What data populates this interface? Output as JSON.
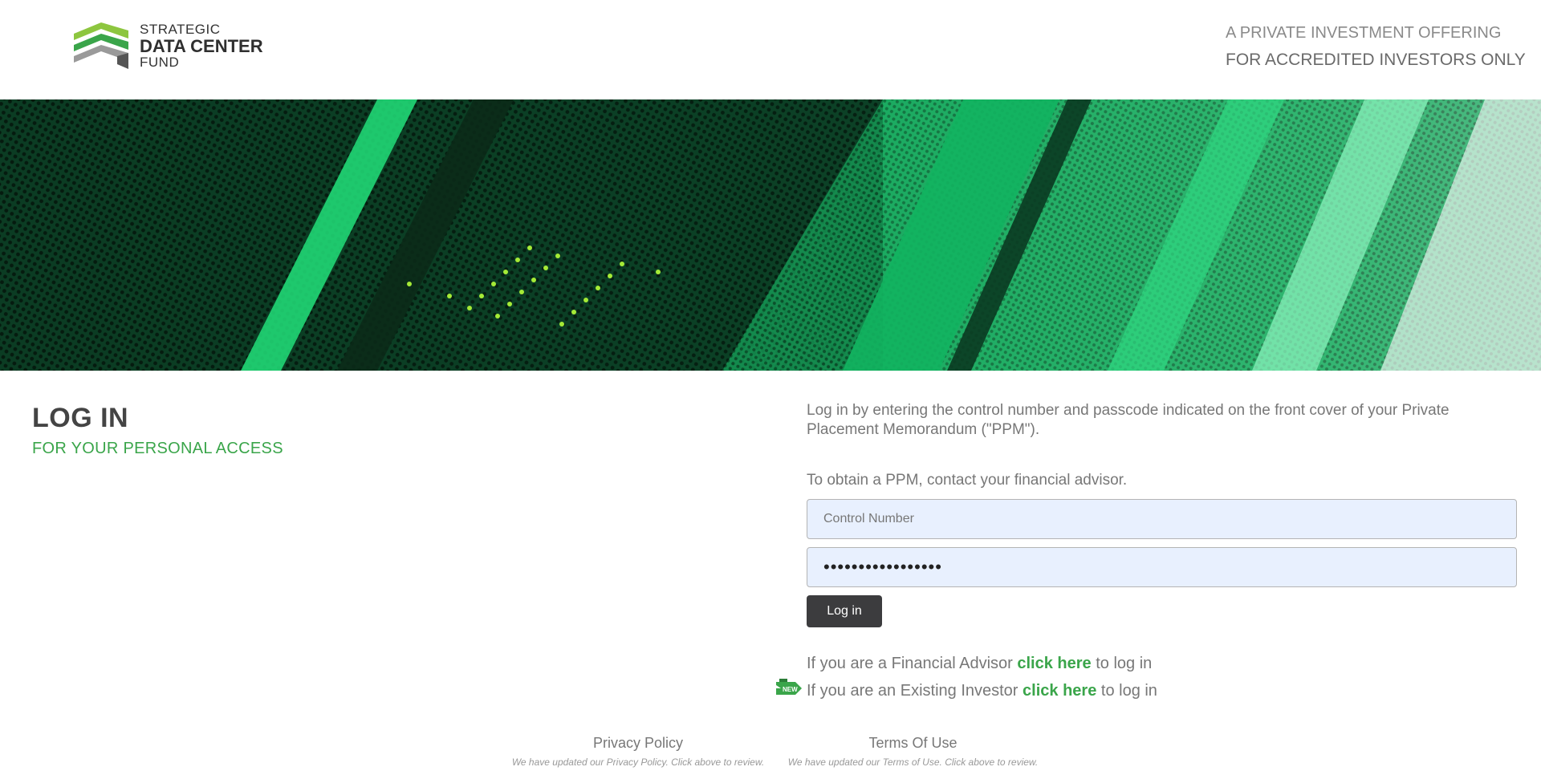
{
  "header": {
    "logo": {
      "line1": "STRATEGIC",
      "line2": "DATA CENTER",
      "line3": "FUND"
    },
    "tagline": {
      "line1": "A PRIVATE INVESTMENT OFFERING",
      "line2": "FOR ACCREDITED INVESTORS ONLY"
    }
  },
  "login": {
    "title": "LOG IN",
    "subtitle": "FOR YOUR PERSONAL ACCESS",
    "intro": "Log in by entering the control number and passcode indicated on the front cover of your Private Placement Memorandum (\"PPM\").",
    "intro2": "To obtain a PPM, contact your financial advisor.",
    "control_placeholder": "Control Number",
    "passcode_value": "•••••••••••••••••",
    "button_label": "Log in"
  },
  "links": {
    "advisor_prefix": "If you are a Financial Advisor ",
    "advisor_link": "click here",
    "advisor_suffix": " to log in",
    "investor_prefix": "If you are an Existing Investor ",
    "investor_link": "click here",
    "investor_suffix": " to log in",
    "new_badge": "NEW"
  },
  "footer": {
    "privacy_label": "Privacy Policy",
    "privacy_note": "We have updated our Privacy Policy. Click above to review.",
    "terms_label": "Terms Of Use",
    "terms_note": "We have updated our Terms of Use. Click above to review."
  },
  "colors": {
    "accent_green": "#3aa54a",
    "button_dark": "#3c3c3e",
    "field_bg": "#e8f0fe"
  },
  "icons": {
    "logo": "chevron-stack-logo-icon",
    "new_badge": "new-arrow-badge-icon"
  }
}
